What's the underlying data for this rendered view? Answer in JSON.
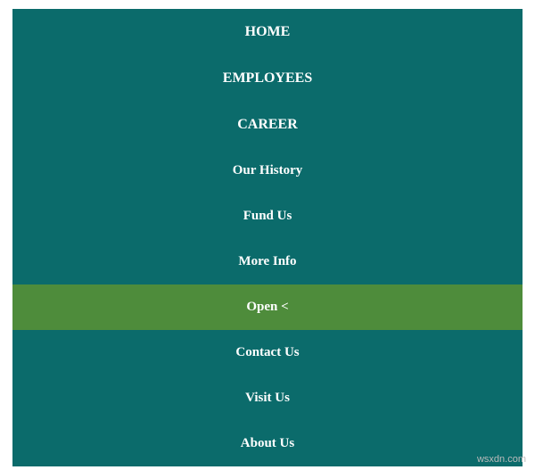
{
  "nav": {
    "items": [
      {
        "label": "HOME",
        "primary": true
      },
      {
        "label": "EMPLOYEES",
        "primary": true
      },
      {
        "label": "CAREER",
        "primary": true
      },
      {
        "label": "Our History",
        "primary": false
      },
      {
        "label": "Fund Us",
        "primary": false
      },
      {
        "label": "More Info",
        "primary": false
      },
      {
        "label": "Open <",
        "primary": false,
        "open": true
      },
      {
        "label": "Contact Us",
        "primary": false
      },
      {
        "label": "Visit Us",
        "primary": false
      },
      {
        "label": "About Us",
        "primary": false
      }
    ]
  },
  "watermark": "wsxdn.com"
}
